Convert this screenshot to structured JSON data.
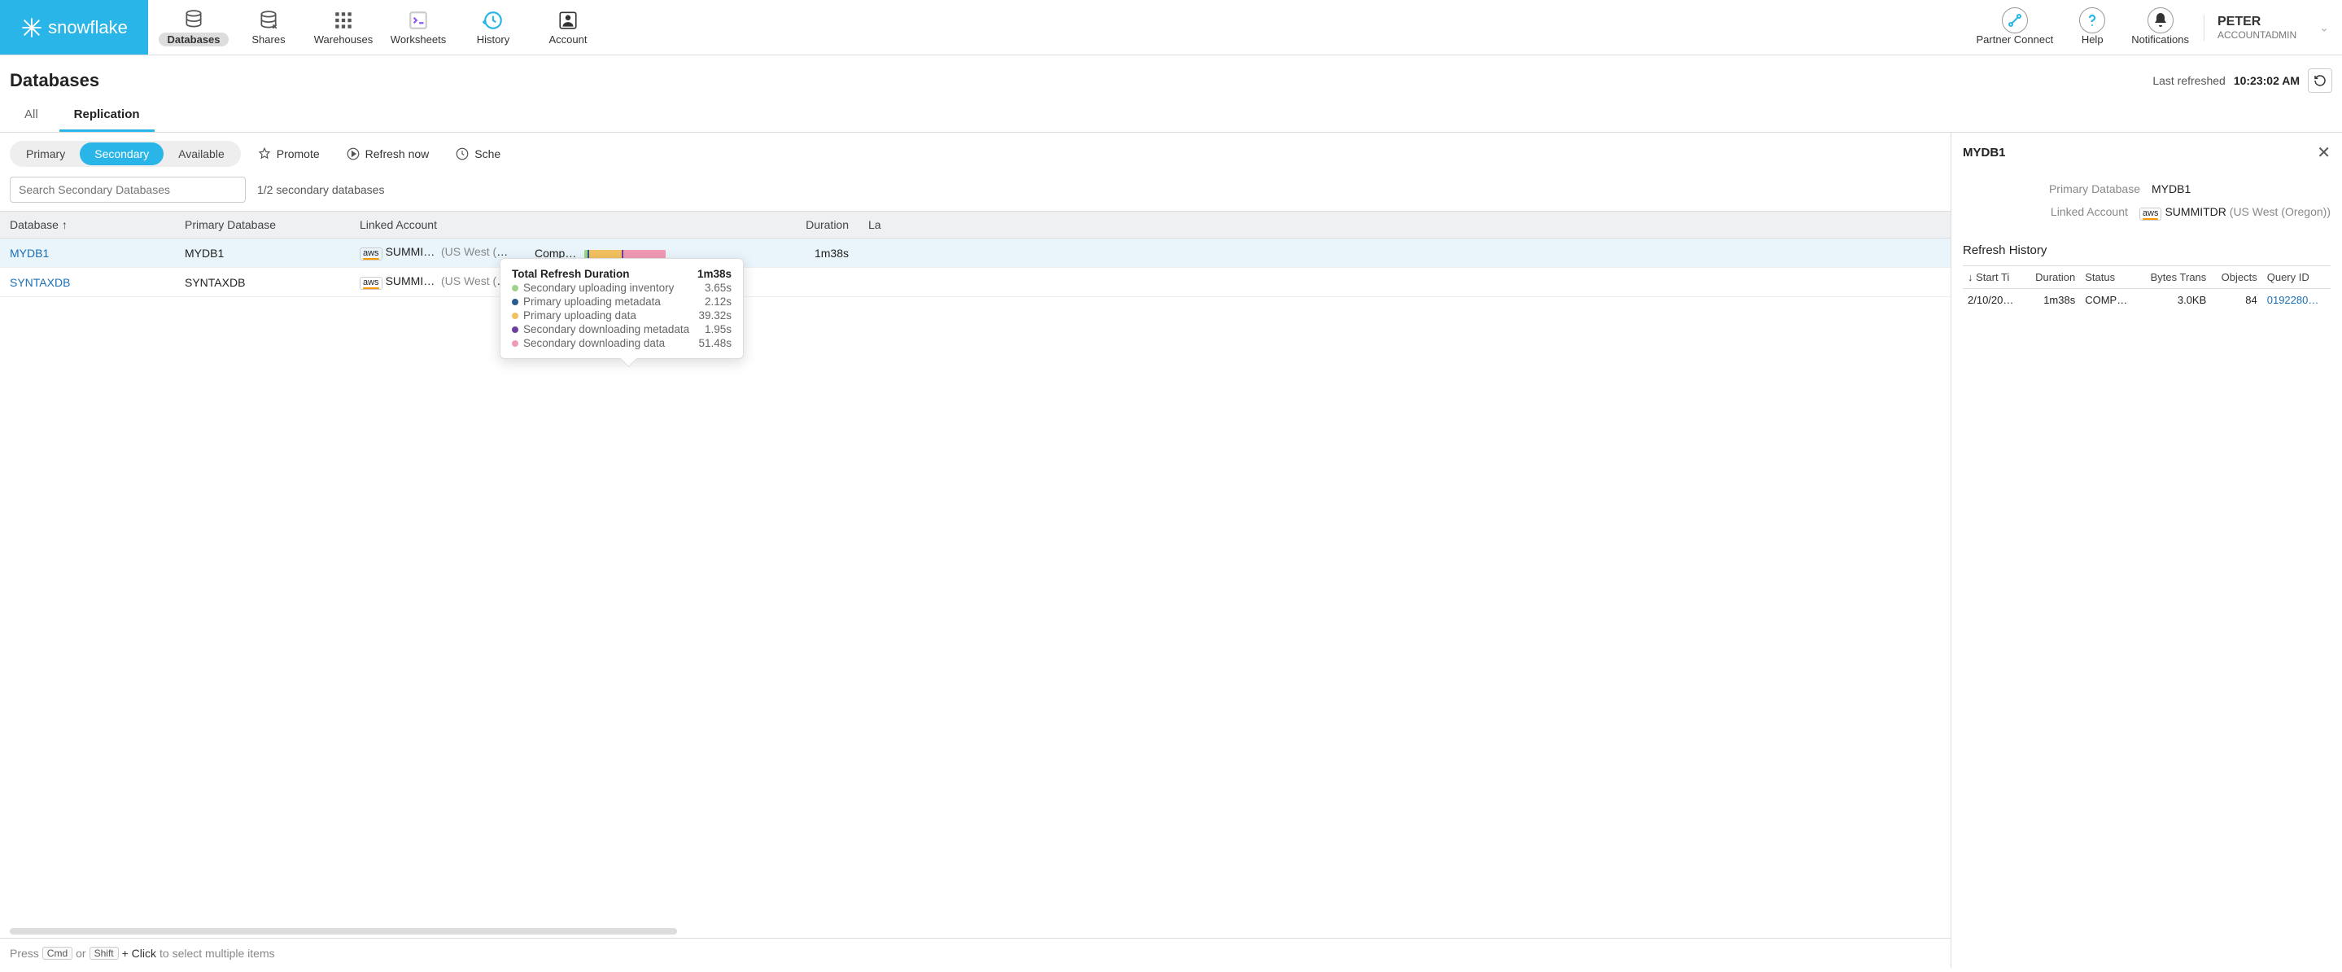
{
  "brand": "snowflake",
  "nav": {
    "items": [
      {
        "label": "Databases",
        "active": true
      },
      {
        "label": "Shares"
      },
      {
        "label": "Warehouses"
      },
      {
        "label": "Worksheets"
      },
      {
        "label": "History"
      },
      {
        "label": "Account"
      }
    ],
    "right": [
      {
        "label": "Partner Connect"
      },
      {
        "label": "Help"
      },
      {
        "label": "Notifications"
      }
    ],
    "user": {
      "name": "PETER",
      "role": "ACCOUNTADMIN"
    }
  },
  "page": {
    "title": "Databases",
    "last_refreshed_label": "Last refreshed",
    "last_refreshed_time": "10:23:02 AM"
  },
  "tabs": [
    {
      "label": "All"
    },
    {
      "label": "Replication",
      "active": true
    }
  ],
  "segments": [
    {
      "label": "Primary"
    },
    {
      "label": "Secondary",
      "active": true
    },
    {
      "label": "Available"
    }
  ],
  "actions": {
    "promote": "Promote",
    "refresh_now": "Refresh now",
    "schedule": "Sche"
  },
  "search": {
    "placeholder": "Search Secondary Databases"
  },
  "count_text": "1/2 secondary databases",
  "columns": {
    "database": "Database",
    "primary_db": "Primary Database",
    "linked": "Linked Account",
    "status": "",
    "duration": "Duration",
    "last": "La"
  },
  "rows": [
    {
      "database": "MYDB1",
      "primary_db": "MYDB1",
      "linked_account": "SUMMI…",
      "linked_region": "(US West (Ore…",
      "status": "Comp…",
      "duration": "1m38s",
      "selected": true,
      "has_bar": true
    },
    {
      "database": "SYNTAXDB",
      "primary_db": "SYNTAXDB",
      "linked_account": "SUMMI…",
      "linked_region": "(US West (Ore…",
      "status": "",
      "duration": "",
      "selected": false,
      "has_bar": false
    }
  ],
  "tooltip": {
    "title": "Total Refresh Duration",
    "total": "1m38s",
    "items": [
      {
        "label": "Secondary uploading inventory",
        "value": "3.65s",
        "color": "#9fd28c"
      },
      {
        "label": "Primary uploading metadata",
        "value": "2.12s",
        "color": "#2b5a8c"
      },
      {
        "label": "Primary uploading data",
        "value": "39.32s",
        "color": "#f2c160"
      },
      {
        "label": "Secondary downloading metadata",
        "value": "1.95s",
        "color": "#6b3fa0"
      },
      {
        "label": "Secondary downloading data",
        "value": "51.48s",
        "color": "#f09ab5"
      }
    ]
  },
  "footer": {
    "press": "Press",
    "cmd": "Cmd",
    "or": "or",
    "shift": "Shift",
    "click": "+ Click",
    "rest": "to select multiple items"
  },
  "detail": {
    "title": "MYDB1",
    "primary_label": "Primary Database",
    "primary_value": "MYDB1",
    "linked_label": "Linked Account",
    "linked_value": "SUMMITDR",
    "linked_region": "(US West (Oregon))",
    "history_title": "Refresh History",
    "history_columns": {
      "start": "Start Ti",
      "duration": "Duration",
      "status": "Status",
      "bytes": "Bytes Trans",
      "objects": "Objects",
      "query": "Query ID"
    },
    "history_rows": [
      {
        "start": "2/10/20…",
        "duration": "1m38s",
        "status": "COMP…",
        "bytes": "3.0KB",
        "objects": "84",
        "query": "0192280…"
      }
    ]
  },
  "chart_data": {
    "type": "bar",
    "title": "Total Refresh Duration",
    "total_seconds": 98,
    "series": [
      {
        "name": "Secondary uploading inventory",
        "seconds": 3.65,
        "color": "#9fd28c"
      },
      {
        "name": "Primary uploading metadata",
        "seconds": 2.12,
        "color": "#2b5a8c"
      },
      {
        "name": "Primary uploading data",
        "seconds": 39.32,
        "color": "#f2c160"
      },
      {
        "name": "Secondary downloading metadata",
        "seconds": 1.95,
        "color": "#6b3fa0"
      },
      {
        "name": "Secondary downloading data",
        "seconds": 51.48,
        "color": "#f09ab5"
      }
    ]
  }
}
